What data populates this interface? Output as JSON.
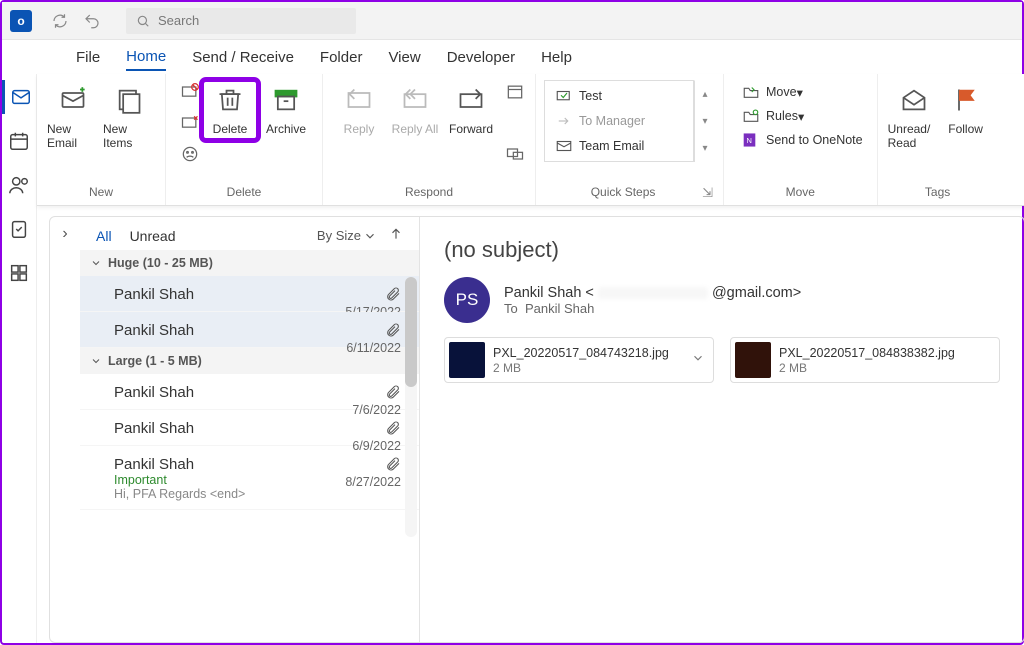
{
  "title_search_placeholder": "Search",
  "menu": {
    "file": "File",
    "home": "Home",
    "sendreceive": "Send / Receive",
    "folder": "Folder",
    "view": "View",
    "developer": "Developer",
    "help": "Help"
  },
  "ribbon": {
    "new_group": "New",
    "new_email": "New Email",
    "new_items": "New Items",
    "delete_group": "Delete",
    "delete": "Delete",
    "archive": "Archive",
    "respond_group": "Respond",
    "reply": "Reply",
    "reply_all": "Reply All",
    "forward": "Forward",
    "quicksteps_group": "Quick Steps",
    "qs_test": "Test",
    "qs_manager": "To Manager",
    "qs_teamemail": "Team Email",
    "move_group": "Move",
    "move": "Move",
    "rules": "Rules",
    "onenote": "Send to OneNote",
    "tags_group": "Tags",
    "unread_read": "Unread/ Read",
    "follow": "Follow"
  },
  "list": {
    "tab_all": "All",
    "tab_unread": "Unread",
    "sort_label": "By Size",
    "groups": [
      {
        "label": "Huge (10 - 25 MB)",
        "items": [
          {
            "sender": "Pankil Shah",
            "date": "5/17/2022"
          },
          {
            "sender": "Pankil Shah",
            "date": "6/11/2022"
          }
        ]
      },
      {
        "label": "Large (1 - 5 MB)",
        "items": [
          {
            "sender": "Pankil Shah",
            "date": "7/6/2022"
          },
          {
            "sender": "Pankil Shah",
            "date": "6/9/2022"
          },
          {
            "sender": "Pankil Shah",
            "date": "8/27/2022",
            "note": "Important",
            "preview": "Hi,  PFA  Regards  <end>"
          }
        ]
      }
    ]
  },
  "reading": {
    "subject": "(no subject)",
    "avatar_initials": "PS",
    "from_name": "Pankil Shah",
    "from_email_suffix": "@gmail.com>",
    "to_label": "To",
    "to_name": "Pankil Shah",
    "attachments": [
      {
        "name": "PXL_20220517_084743218.jpg",
        "size": "2 MB"
      },
      {
        "name": "PXL_20220517_084838382.jpg",
        "size": "2 MB"
      }
    ]
  }
}
